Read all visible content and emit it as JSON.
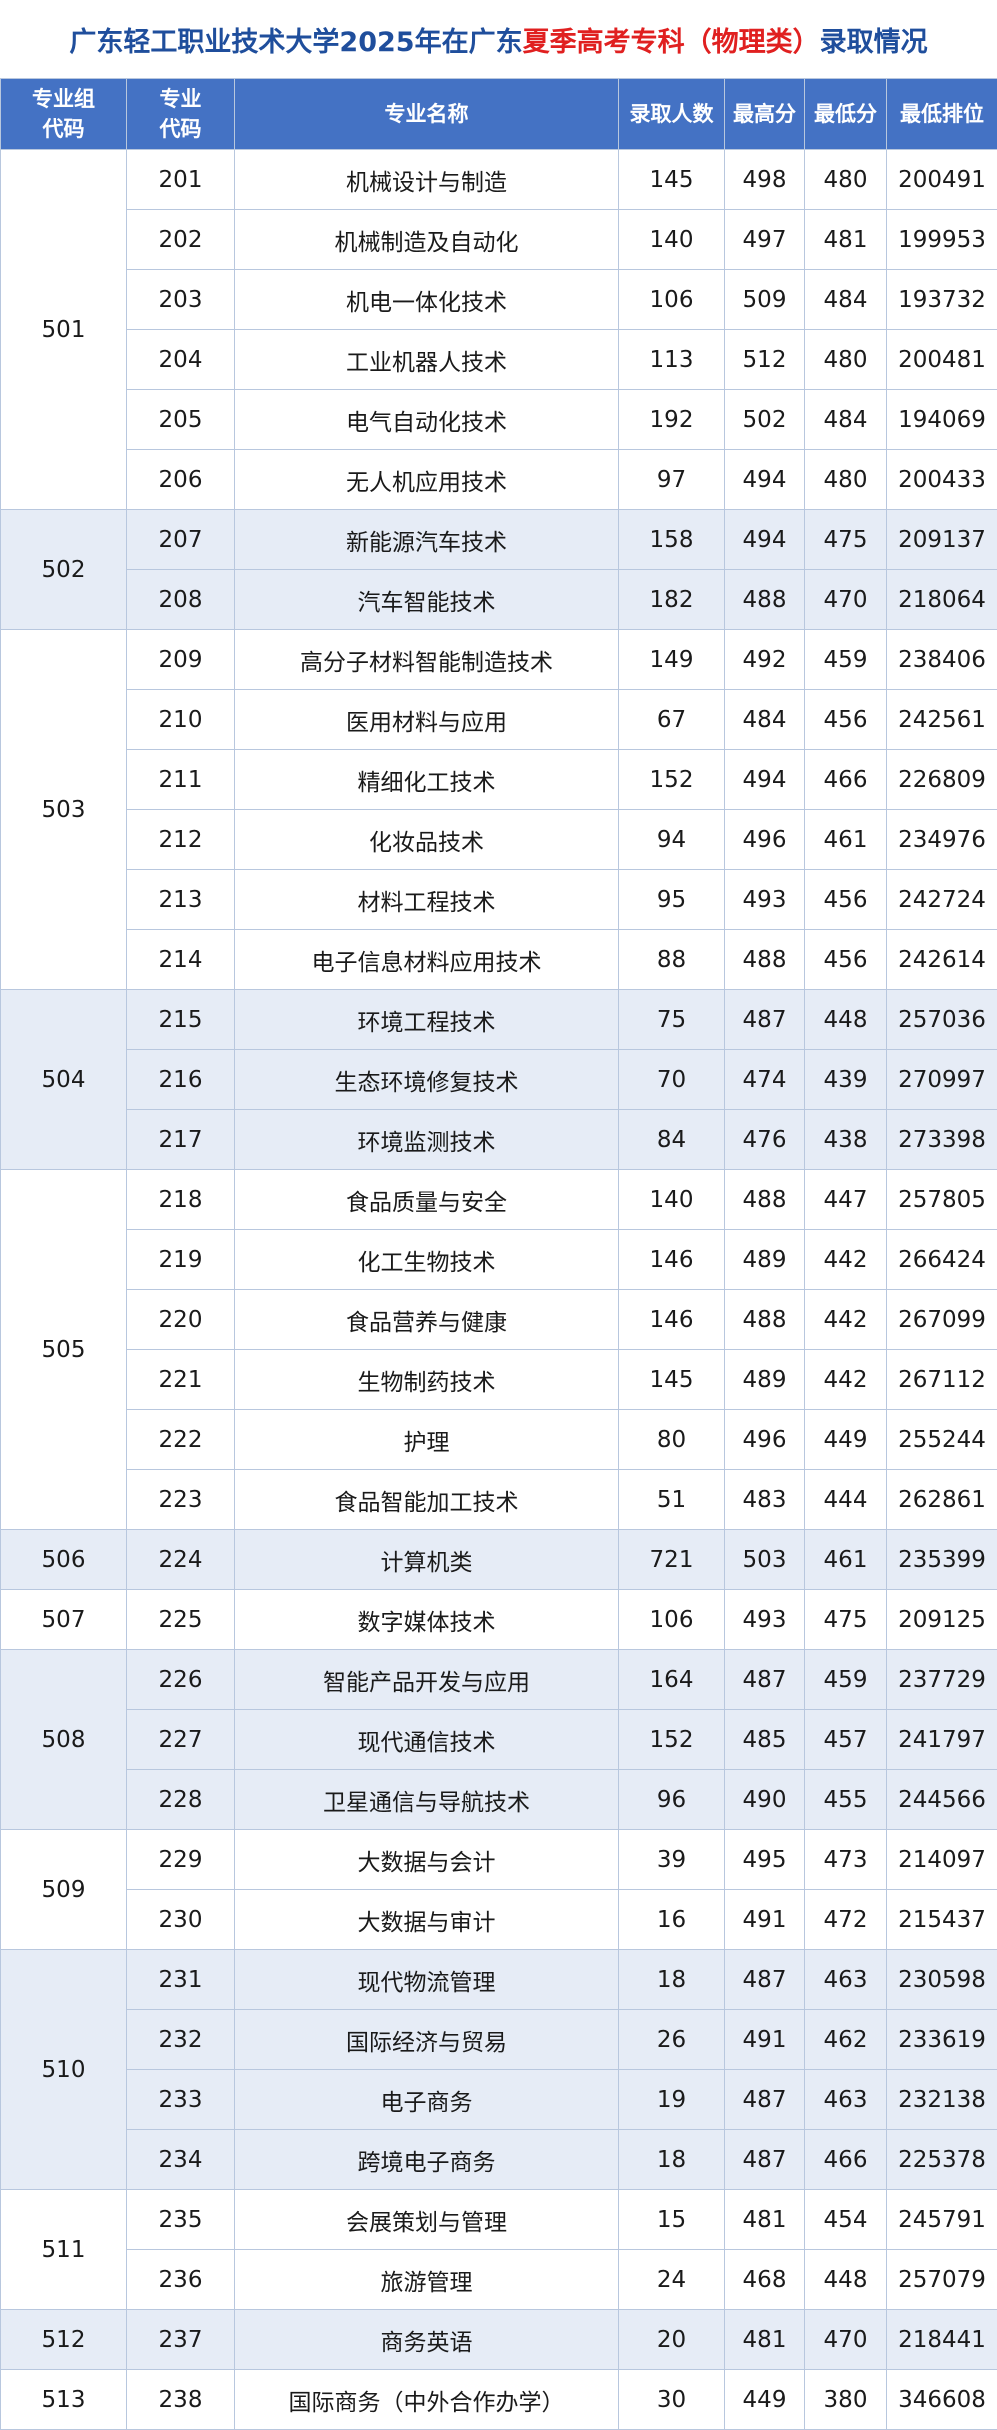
{
  "title": {
    "part1": "广东轻工职业技术大学2025年在广东",
    "highlight": "夏季高考专科（物理类）",
    "part2": "录取情况"
  },
  "headers": {
    "group_code_line1": "专业组",
    "group_code_line2": "代码",
    "major_code_line1": "专业",
    "major_code_line2": "代码",
    "major_name": "专业名称",
    "admitted": "录取人数",
    "max_score": "最高分",
    "min_score": "最低分",
    "min_rank": "最低排位"
  },
  "groups": [
    {
      "code": "501",
      "rows": [
        [
          "201",
          "机械设计与制造",
          "145",
          "498",
          "480",
          "200491"
        ],
        [
          "202",
          "机械制造及自动化",
          "140",
          "497",
          "481",
          "199953"
        ],
        [
          "203",
          "机电一体化技术",
          "106",
          "509",
          "484",
          "193732"
        ],
        [
          "204",
          "工业机器人技术",
          "113",
          "512",
          "480",
          "200481"
        ],
        [
          "205",
          "电气自动化技术",
          "192",
          "502",
          "484",
          "194069"
        ],
        [
          "206",
          "无人机应用技术",
          "97",
          "494",
          "480",
          "200433"
        ]
      ]
    },
    {
      "code": "502",
      "rows": [
        [
          "207",
          "新能源汽车技术",
          "158",
          "494",
          "475",
          "209137"
        ],
        [
          "208",
          "汽车智能技术",
          "182",
          "488",
          "470",
          "218064"
        ]
      ]
    },
    {
      "code": "503",
      "rows": [
        [
          "209",
          "高分子材料智能制造技术",
          "149",
          "492",
          "459",
          "238406"
        ],
        [
          "210",
          "医用材料与应用",
          "67",
          "484",
          "456",
          "242561"
        ],
        [
          "211",
          "精细化工技术",
          "152",
          "494",
          "466",
          "226809"
        ],
        [
          "212",
          "化妆品技术",
          "94",
          "496",
          "461",
          "234976"
        ],
        [
          "213",
          "材料工程技术",
          "95",
          "493",
          "456",
          "242724"
        ],
        [
          "214",
          "电子信息材料应用技术",
          "88",
          "488",
          "456",
          "242614"
        ]
      ]
    },
    {
      "code": "504",
      "rows": [
        [
          "215",
          "环境工程技术",
          "75",
          "487",
          "448",
          "257036"
        ],
        [
          "216",
          "生态环境修复技术",
          "70",
          "474",
          "439",
          "270997"
        ],
        [
          "217",
          "环境监测技术",
          "84",
          "476",
          "438",
          "273398"
        ]
      ]
    },
    {
      "code": "505",
      "rows": [
        [
          "218",
          "食品质量与安全",
          "140",
          "488",
          "447",
          "257805"
        ],
        [
          "219",
          "化工生物技术",
          "146",
          "489",
          "442",
          "266424"
        ],
        [
          "220",
          "食品营养与健康",
          "146",
          "488",
          "442",
          "267099"
        ],
        [
          "221",
          "生物制药技术",
          "145",
          "489",
          "442",
          "267112"
        ],
        [
          "222",
          "护理",
          "80",
          "496",
          "449",
          "255244"
        ],
        [
          "223",
          "食品智能加工技术",
          "51",
          "483",
          "444",
          "262861"
        ]
      ]
    },
    {
      "code": "506",
      "rows": [
        [
          "224",
          "计算机类",
          "721",
          "503",
          "461",
          "235399"
        ]
      ]
    },
    {
      "code": "507",
      "rows": [
        [
          "225",
          "数字媒体技术",
          "106",
          "493",
          "475",
          "209125"
        ]
      ]
    },
    {
      "code": "508",
      "rows": [
        [
          "226",
          "智能产品开发与应用",
          "164",
          "487",
          "459",
          "237729"
        ],
        [
          "227",
          "现代通信技术",
          "152",
          "485",
          "457",
          "241797"
        ],
        [
          "228",
          "卫星通信与导航技术",
          "96",
          "490",
          "455",
          "244566"
        ]
      ]
    },
    {
      "code": "509",
      "rows": [
        [
          "229",
          "大数据与会计",
          "39",
          "495",
          "473",
          "214097"
        ],
        [
          "230",
          "大数据与审计",
          "16",
          "491",
          "472",
          "215437"
        ]
      ]
    },
    {
      "code": "510",
      "rows": [
        [
          "231",
          "现代物流管理",
          "18",
          "487",
          "463",
          "230598"
        ],
        [
          "232",
          "国际经济与贸易",
          "26",
          "491",
          "462",
          "233619"
        ],
        [
          "233",
          "电子商务",
          "19",
          "487",
          "463",
          "232138"
        ],
        [
          "234",
          "跨境电子商务",
          "18",
          "487",
          "466",
          "225378"
        ]
      ]
    },
    {
      "code": "511",
      "rows": [
        [
          "235",
          "会展策划与管理",
          "15",
          "481",
          "454",
          "245791"
        ],
        [
          "236",
          "旅游管理",
          "24",
          "468",
          "448",
          "257079"
        ]
      ]
    },
    {
      "code": "512",
      "rows": [
        [
          "237",
          "商务英语",
          "20",
          "481",
          "470",
          "218441"
        ]
      ]
    },
    {
      "code": "513",
      "rows": [
        [
          "238",
          "国际商务（中外合作办学）",
          "30",
          "449",
          "380",
          "346608"
        ]
      ]
    }
  ]
}
